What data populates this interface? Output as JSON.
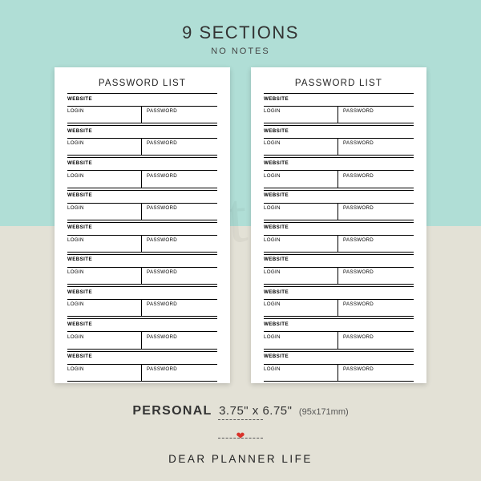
{
  "heading": {
    "title": "9 SECTIONS",
    "subtitle": "NO NOTES"
  },
  "card": {
    "title": "PASSWORD LIST",
    "labels": {
      "website": "WEBSITE",
      "login": "LOGIN",
      "password": "PASSWORD"
    }
  },
  "watermark": "printable",
  "dimensions": {
    "label": "PERSONAL",
    "inches": "3.75\" x 6.75\"",
    "mm": "(95x171mm)"
  },
  "brand": {
    "name": "DEAR PLANNER LIFE"
  }
}
